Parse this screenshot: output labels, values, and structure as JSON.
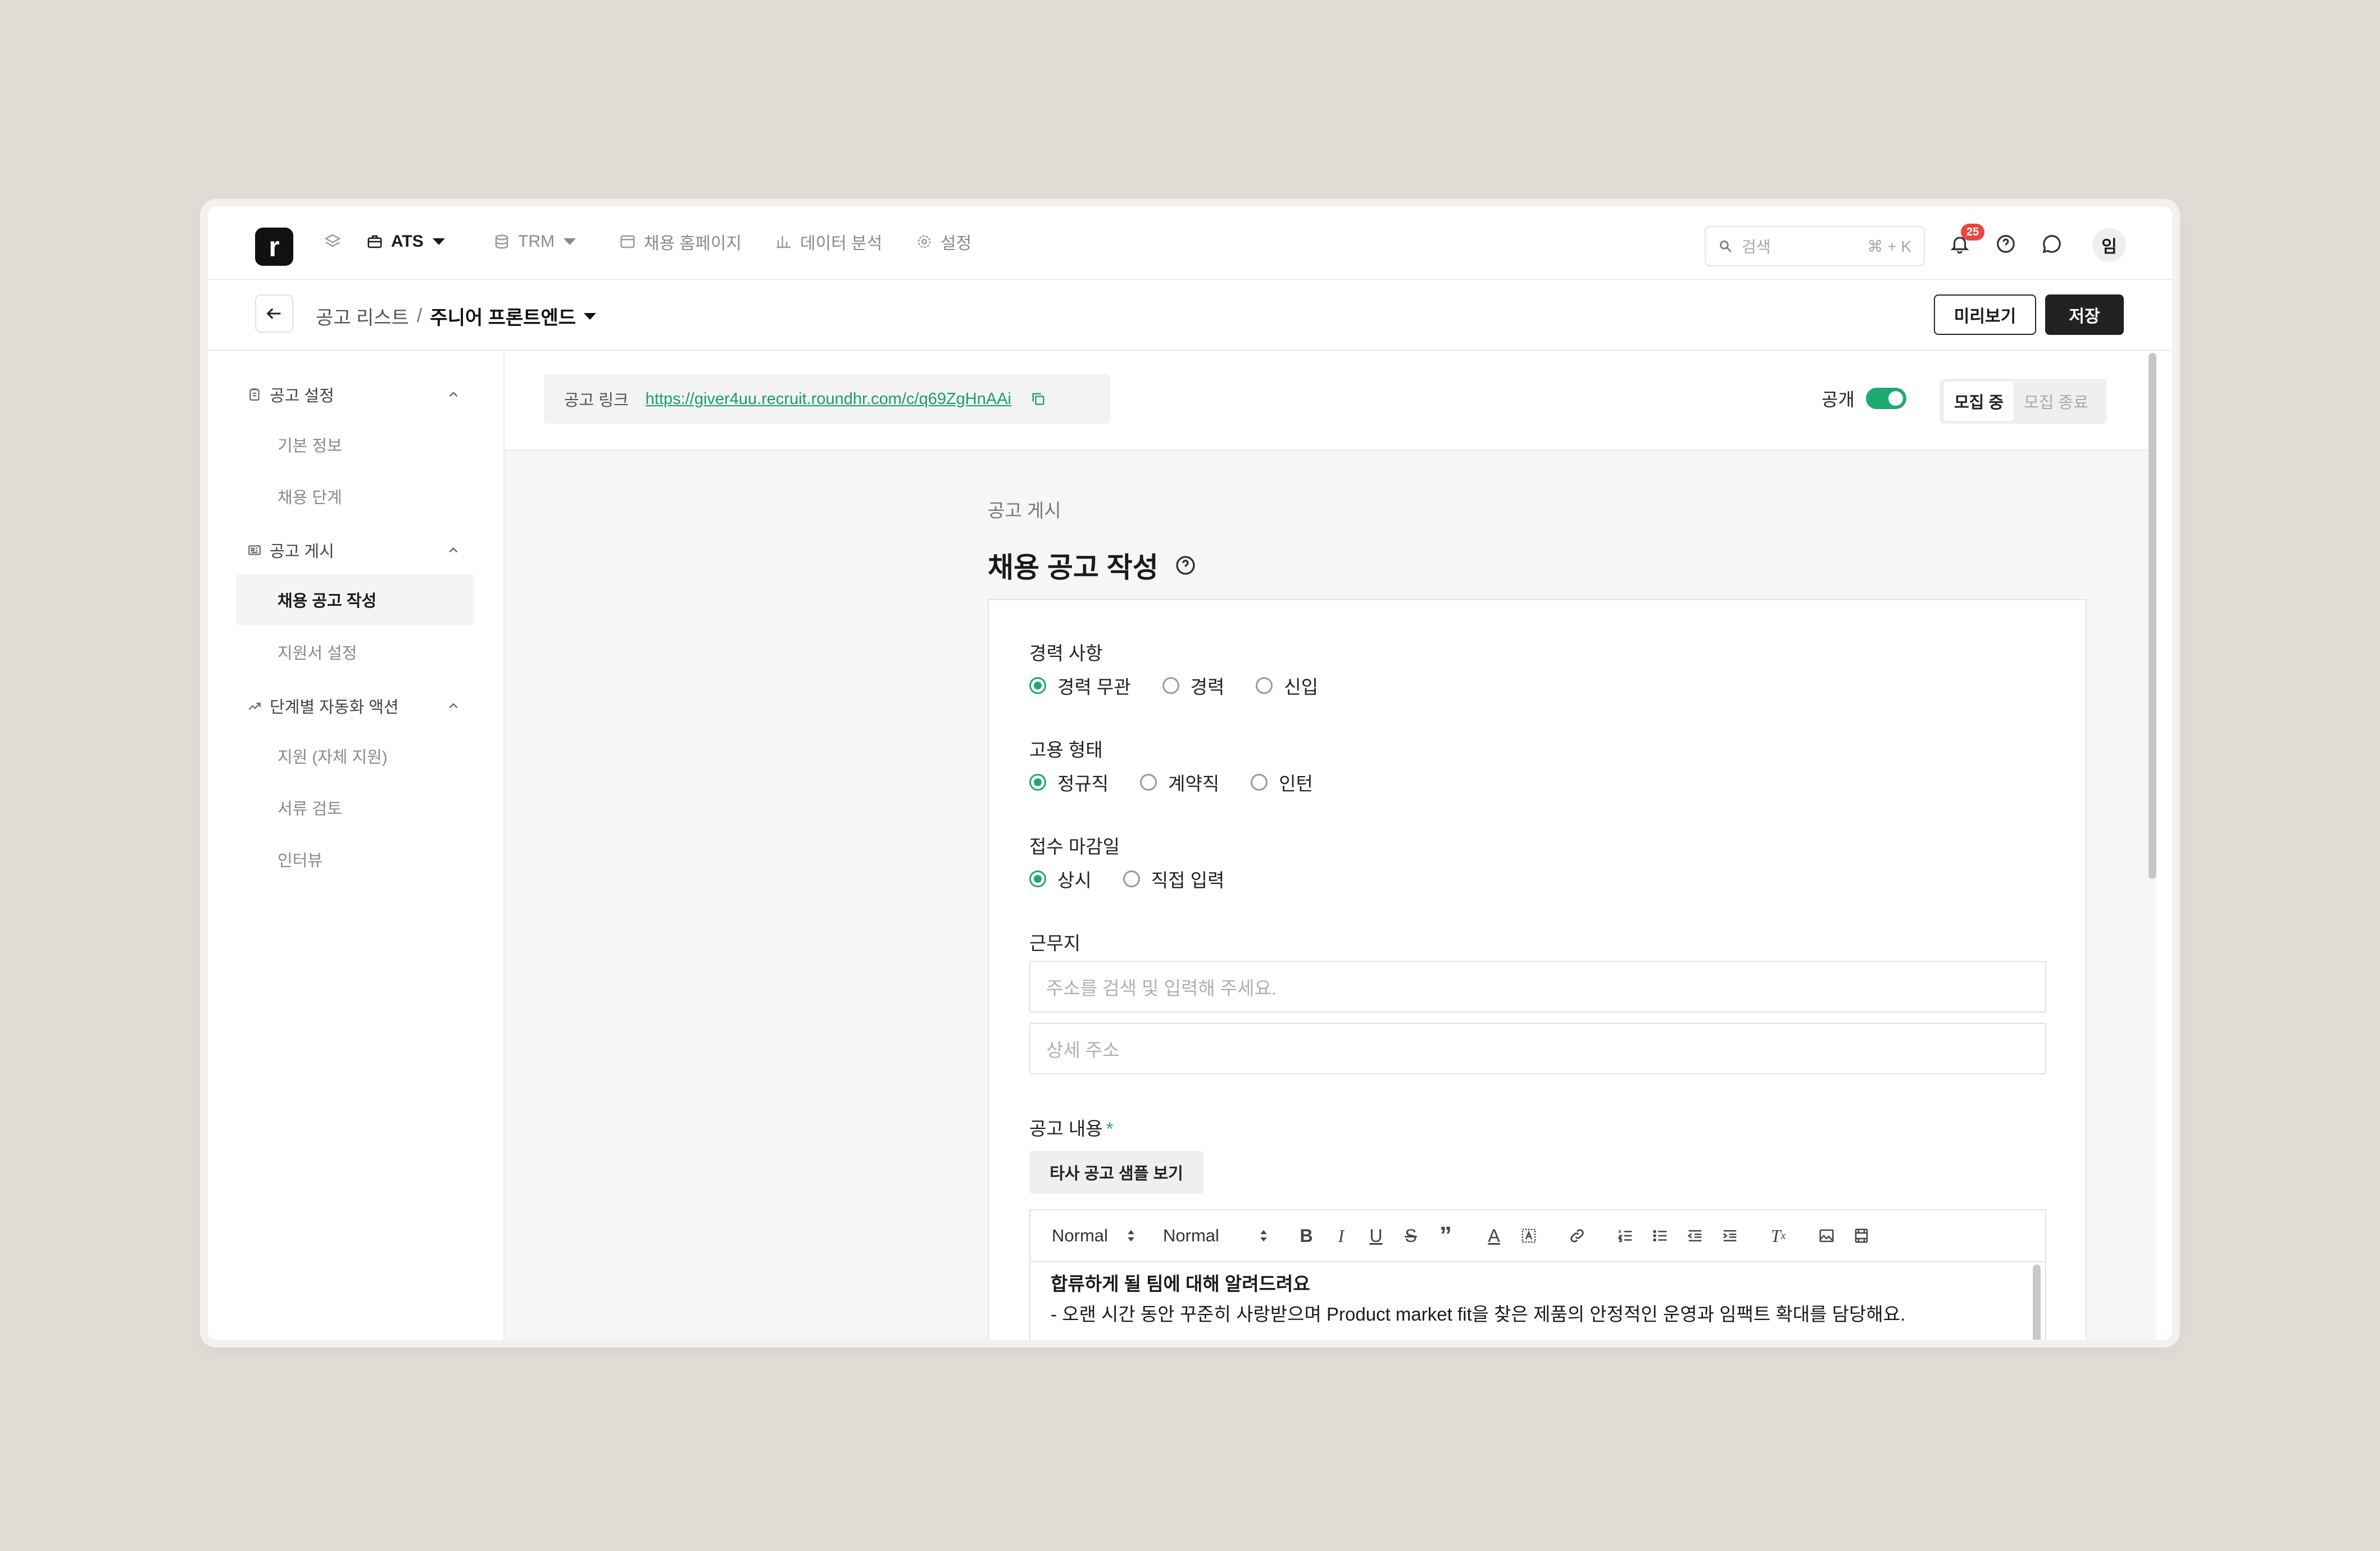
{
  "app": {
    "logo_letter": "r"
  },
  "topnav": {
    "items": [
      {
        "label": "ATS",
        "icon": "briefcase-icon"
      },
      {
        "label": "TRM",
        "icon": "database-icon"
      },
      {
        "label": "채용 홈페이지",
        "icon": "browser-icon"
      },
      {
        "label": "데이터 분석",
        "icon": "bar-chart-icon"
      },
      {
        "label": "설정",
        "icon": "gear-icon"
      }
    ],
    "search": {
      "placeholder": "검색",
      "shortcut": "⌘ + K"
    },
    "notification_count": "25",
    "avatar_initial": "임"
  },
  "subheader": {
    "breadcrumb_parent": "공고 리스트",
    "breadcrumb_sep": "/",
    "breadcrumb_current": "주니어 프론트엔드",
    "preview_label": "미리보기",
    "save_label": "저장"
  },
  "sidebar": {
    "sections": [
      {
        "label": "공고 설정",
        "icon": "clipboard-icon",
        "items": [
          "기본 정보",
          "채용 단계"
        ]
      },
      {
        "label": "공고 게시",
        "icon": "newspaper-icon",
        "items": [
          "채용 공고 작성",
          "지원서 설정"
        ]
      },
      {
        "label": "단계별 자동화 액션",
        "icon": "trend-icon",
        "items": [
          "지원 (자체 지원)",
          "서류 검토",
          "인터뷰"
        ]
      }
    ],
    "active_item": "채용 공고 작성"
  },
  "linkbar": {
    "label": "공고 링크",
    "url": "https://giver4uu.recruit.roundhr.com/c/q69ZgHnAAi",
    "public_label": "공개",
    "public_on": true,
    "status_options": [
      "모집 중",
      "모집 종료"
    ],
    "status_selected": "모집 중"
  },
  "content": {
    "section_label": "공고 게시",
    "title": "채용 공고 작성",
    "career": {
      "label": "경력 사항",
      "options": [
        "경력 무관",
        "경력",
        "신입"
      ],
      "selected": "경력 무관"
    },
    "employment": {
      "label": "고용 형태",
      "options": [
        "정규직",
        "계약직",
        "인턴"
      ],
      "selected": "정규직"
    },
    "deadline": {
      "label": "접수 마감일",
      "options": [
        "상시",
        "직접 입력"
      ],
      "selected": "상시"
    },
    "location": {
      "label": "근무지",
      "address_placeholder": "주소를 검색 및 입력해 주세요.",
      "detail_placeholder": "상세 주소"
    },
    "description": {
      "label": "공고 내용",
      "required_mark": "*",
      "sample_button": "타사 공고 샘플 보기",
      "toolbar": {
        "heading_select": "Normal",
        "size_select": "Normal"
      },
      "body_heading": "합류하게 될 팀에 대해 알려드려요",
      "body_line": "- 오랜 시간 동안 꾸준히 사랑받으며 Product market fit을 찾은 제품의 안정적인 운영과 임팩트 확대를 담당해요."
    }
  },
  "colors": {
    "accent": "#1fa971",
    "badge": "#e8473f",
    "dark_button": "#222222",
    "background": "#e0dbd5"
  }
}
